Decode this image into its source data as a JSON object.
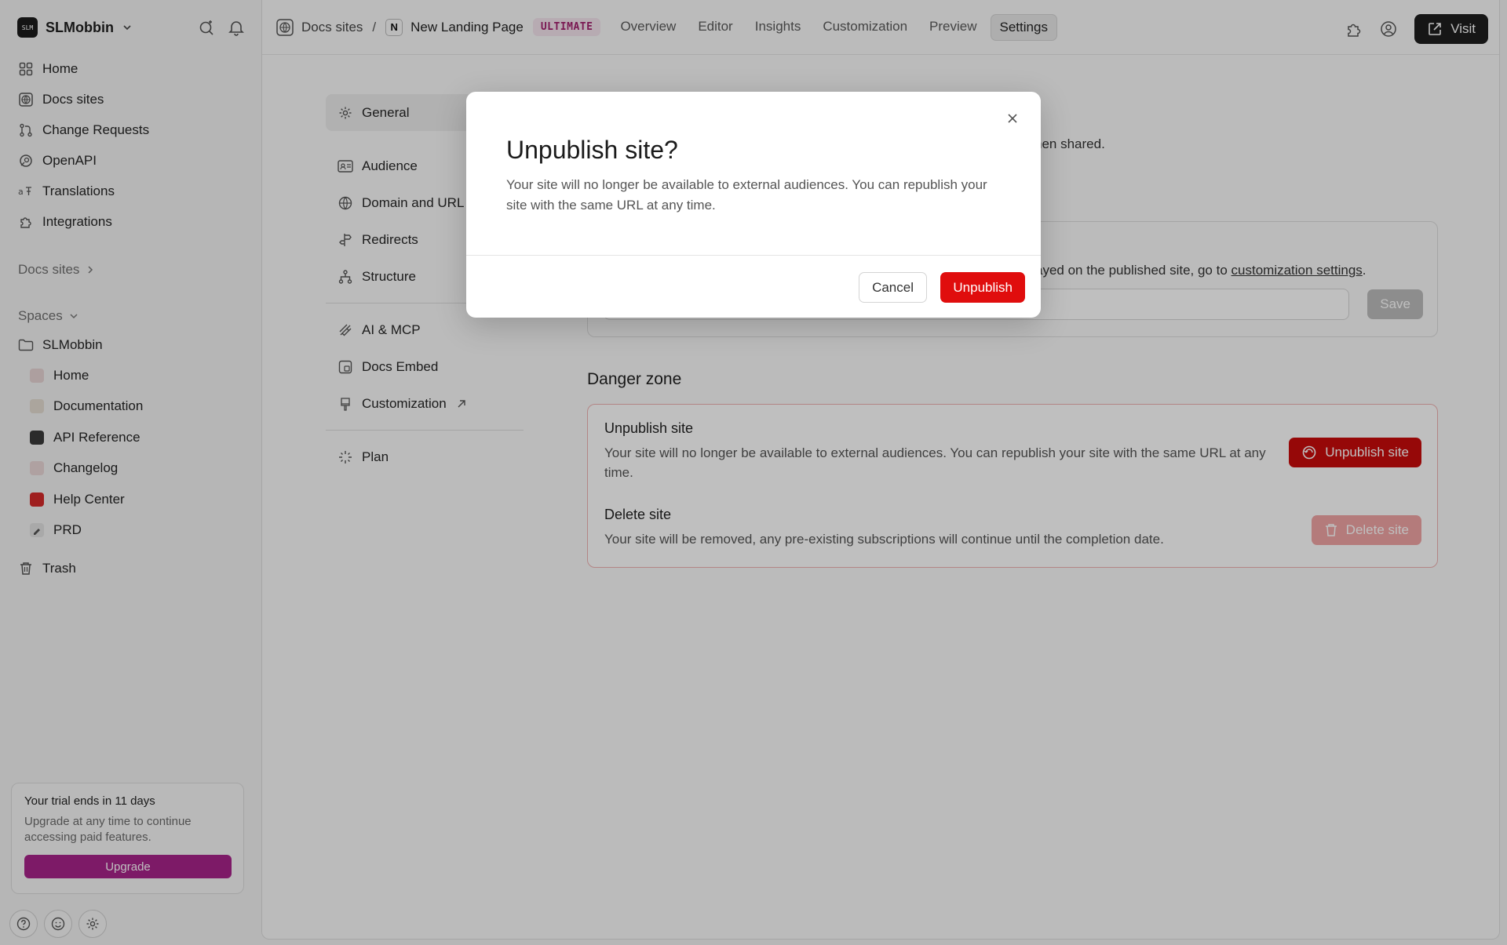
{
  "workspace": {
    "name": "SLMobbin",
    "logo_text": "SLM"
  },
  "nav": [
    {
      "label": "Home",
      "icon": "grid-icon"
    },
    {
      "label": "Docs sites",
      "icon": "globe-icon"
    },
    {
      "label": "Change Requests",
      "icon": "branch-icon"
    },
    {
      "label": "OpenAPI",
      "icon": "openapi-icon"
    },
    {
      "label": "Translations",
      "icon": "translate-icon"
    },
    {
      "label": "Integrations",
      "icon": "puzzle-icon"
    }
  ],
  "sections": {
    "docs_sites": "Docs sites",
    "spaces": "Spaces"
  },
  "spaces": {
    "root": "SLMobbin",
    "items": [
      {
        "label": "Home",
        "color": "#d8b4b4"
      },
      {
        "label": "Documentation",
        "color": "#d9d0c2"
      },
      {
        "label": "API Reference",
        "color": "#444444"
      },
      {
        "label": "Changelog",
        "color": "#e3c9c9"
      },
      {
        "label": "Help Center",
        "color": "#d42a2a"
      },
      {
        "label": "PRD",
        "color": "#cccccc"
      }
    ]
  },
  "trash": "Trash",
  "trial": {
    "title": "Your trial ends in 11 days",
    "desc": "Upgrade at any time to continue accessing paid features.",
    "button": "Upgrade"
  },
  "topbar": {
    "crumb_root": "Docs sites",
    "crumb_sep": "/",
    "site_icon": "N",
    "site_name": "New Landing Page",
    "plan_badge": "ULTIMATE",
    "tabs": [
      "Overview",
      "Editor",
      "Insights",
      "Customization",
      "Preview",
      "Settings"
    ],
    "active_tab": "Settings",
    "visit": "Visit"
  },
  "settings_nav": {
    "group1": [
      "General",
      "Audience",
      "Domain and URL",
      "Redirects",
      "Structure"
    ],
    "group2": [
      "AI & MCP",
      "Docs Embed",
      "Customization"
    ],
    "group3": [
      "Plan"
    ],
    "active": "General"
  },
  "background": {
    "shared_tail": "hen shared.",
    "custom_tail": "ayed on the published site, go to",
    "custom_link": "customization settings",
    "save": "Save",
    "danger_title": "Danger zone",
    "unpublish_title": "Unpublish site",
    "unpublish_desc": "Your site will no longer be available to external audiences. You can republish your site with the same URL at any time.",
    "unpublish_btn": "Unpublish site",
    "delete_title": "Delete site",
    "delete_desc": "Your site will be removed, any pre-existing subscriptions will continue until the completion date.",
    "delete_btn": "Delete site"
  },
  "modal": {
    "title": "Unpublish site?",
    "body": "Your site will no longer be available to external audiences. You can republish your site with the same URL at any time.",
    "cancel": "Cancel",
    "confirm": "Unpublish"
  }
}
